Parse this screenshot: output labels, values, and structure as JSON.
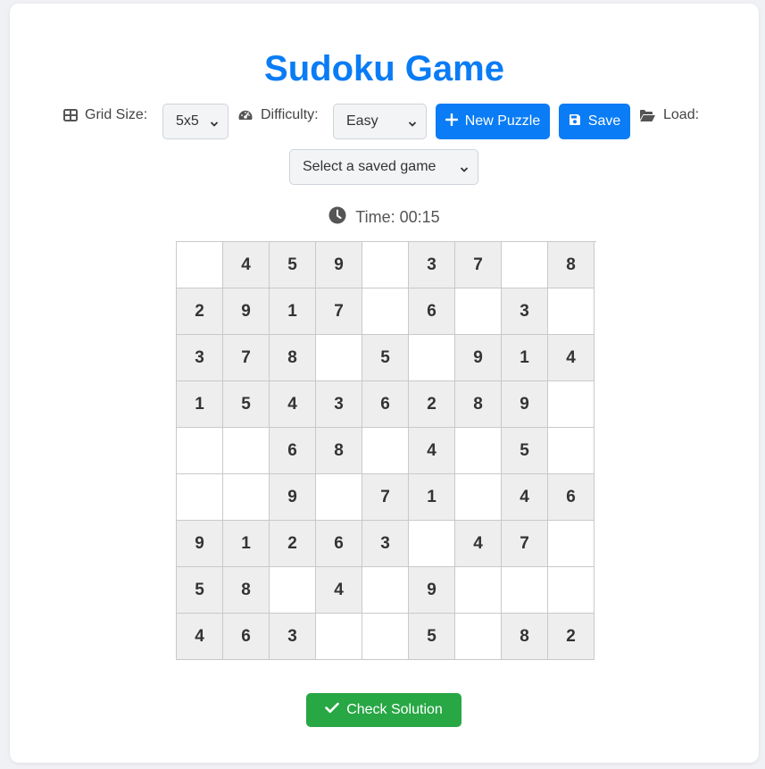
{
  "title": "Sudoku Game",
  "controls": {
    "grid_size_label": "Grid Size:",
    "grid_size_value": "5x5",
    "difficulty_label": "Difficulty:",
    "difficulty_value": "Easy",
    "new_puzzle_label": "New Puzzle",
    "save_label": "Save",
    "load_label": "Load:",
    "saved_game_placeholder": "Select a saved game"
  },
  "timer": {
    "label": "Time: 00:15"
  },
  "board": {
    "rows": [
      [
        "",
        "4",
        "5",
        "9",
        "",
        "3",
        "7",
        "",
        "8"
      ],
      [
        "2",
        "9",
        "1",
        "7",
        "",
        "6",
        "",
        "3",
        ""
      ],
      [
        "3",
        "7",
        "8",
        "",
        "5",
        "",
        "9",
        "1",
        "4"
      ],
      [
        "1",
        "5",
        "4",
        "3",
        "6",
        "2",
        "8",
        "9",
        ""
      ],
      [
        "",
        "",
        "6",
        "8",
        "",
        "4",
        "",
        "5",
        ""
      ],
      [
        "",
        "",
        "9",
        "",
        "7",
        "1",
        "",
        "4",
        "6"
      ],
      [
        "9",
        "1",
        "2",
        "6",
        "3",
        "",
        "4",
        "7",
        ""
      ],
      [
        "5",
        "8",
        "",
        "4",
        "",
        "9",
        "",
        "",
        ""
      ],
      [
        "4",
        "6",
        "3",
        "",
        "",
        "5",
        "",
        "8",
        "2"
      ]
    ]
  },
  "check_label": "Check Solution",
  "colors": {
    "accent": "#0a7cf5",
    "success": "#28a745",
    "given_cell": "#eeeeee"
  }
}
